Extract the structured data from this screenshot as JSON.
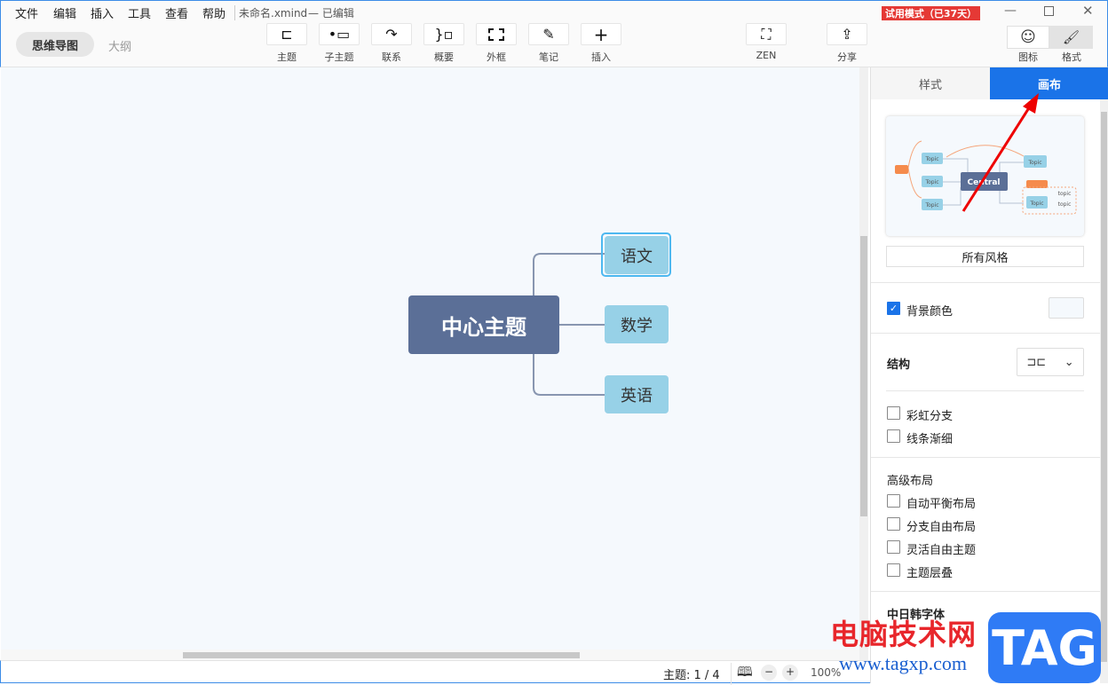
{
  "menu": [
    "文件",
    "编辑",
    "插入",
    "工具",
    "查看",
    "帮助"
  ],
  "doc_title": "未命名.xmind",
  "doc_status": "— 已编辑",
  "view_tabs": {
    "mindmap": "思维导图",
    "outline": "大纲"
  },
  "toolbar": [
    {
      "label": "主题",
      "icon": "topic-icon"
    },
    {
      "label": "子主题",
      "icon": "subtopic-icon"
    },
    {
      "label": "联系",
      "icon": "relationship-icon"
    },
    {
      "label": "概要",
      "icon": "summary-icon"
    },
    {
      "label": "外框",
      "icon": "boundary-icon"
    },
    {
      "label": "笔记",
      "icon": "note-icon"
    },
    {
      "label": "插入",
      "icon": "plus-icon"
    }
  ],
  "zen": "ZEN",
  "share": "分享",
  "trial": "试用模式（已37天）",
  "side_tabs": {
    "icon": "图标",
    "format": "格式"
  },
  "mindmap": {
    "central": "中心主题",
    "children": [
      "语文",
      "数学",
      "英语"
    ],
    "selected": "语文"
  },
  "panel": {
    "tabs": [
      "样式",
      "画布"
    ],
    "active_tab": "画布",
    "preview": {
      "central": "Central",
      "topic": "Topic",
      "small": "topic"
    },
    "all_styles": "所有风格",
    "bg_color": {
      "label": "背景颜色",
      "checked": true
    },
    "structure": "结构",
    "options": [
      {
        "label": "彩虹分支",
        "checked": false
      },
      {
        "label": "线条渐细",
        "checked": false
      }
    ],
    "advanced": "高级布局",
    "advanced_options": [
      {
        "label": "自动平衡布局",
        "checked": false
      },
      {
        "label": "分支自由布局",
        "checked": false
      },
      {
        "label": "灵活自由主题",
        "checked": false
      },
      {
        "label": "主题层叠",
        "checked": false
      }
    ],
    "cjk_font": "中日韩字体"
  },
  "status": {
    "topics": "主题: 1 / 4",
    "zoom": "100%"
  },
  "colors": {
    "accent": "#1a73e8",
    "central": "#5b6f97",
    "subtopic": "#97d1e7",
    "trial": "#e53935"
  },
  "watermark": {
    "cn": "电脑技术网",
    "url": "www.tagxp.com",
    "logo": "TAG"
  }
}
